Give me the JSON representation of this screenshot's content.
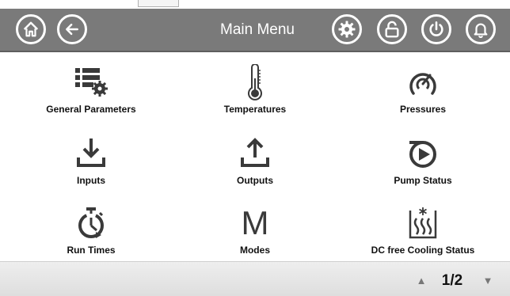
{
  "header": {
    "title": "Main Menu",
    "left_buttons": [
      "home-icon",
      "back-arrow-icon"
    ],
    "right_buttons": [
      "gear-icon",
      "unlock-icon",
      "power-icon",
      "bell-icon"
    ]
  },
  "menu": {
    "items": [
      {
        "label": "General Parameters",
        "icon": "parameters-list-gear-icon"
      },
      {
        "label": "Temperatures",
        "icon": "thermometer-icon"
      },
      {
        "label": "Pressures",
        "icon": "pressure-gauge-icon"
      },
      {
        "label": "Inputs",
        "icon": "download-input-icon"
      },
      {
        "label": "Outputs",
        "icon": "upload-output-icon"
      },
      {
        "label": "Pump Status",
        "icon": "pump-play-icon"
      },
      {
        "label": "Run Times",
        "icon": "stopwatch-icon"
      },
      {
        "label": "Modes",
        "icon": "modes-m-icon",
        "glyph": "M"
      },
      {
        "label": "DC free Cooling Status",
        "icon": "free-cooling-icon"
      }
    ]
  },
  "pagination": {
    "page": "1/2",
    "up_icon": "▲",
    "down_icon": "▼"
  },
  "colors": {
    "header_bg": "#7a7a7a",
    "icon_color": "#3a3a3a",
    "bottom_bar": "#e6e6e6"
  }
}
